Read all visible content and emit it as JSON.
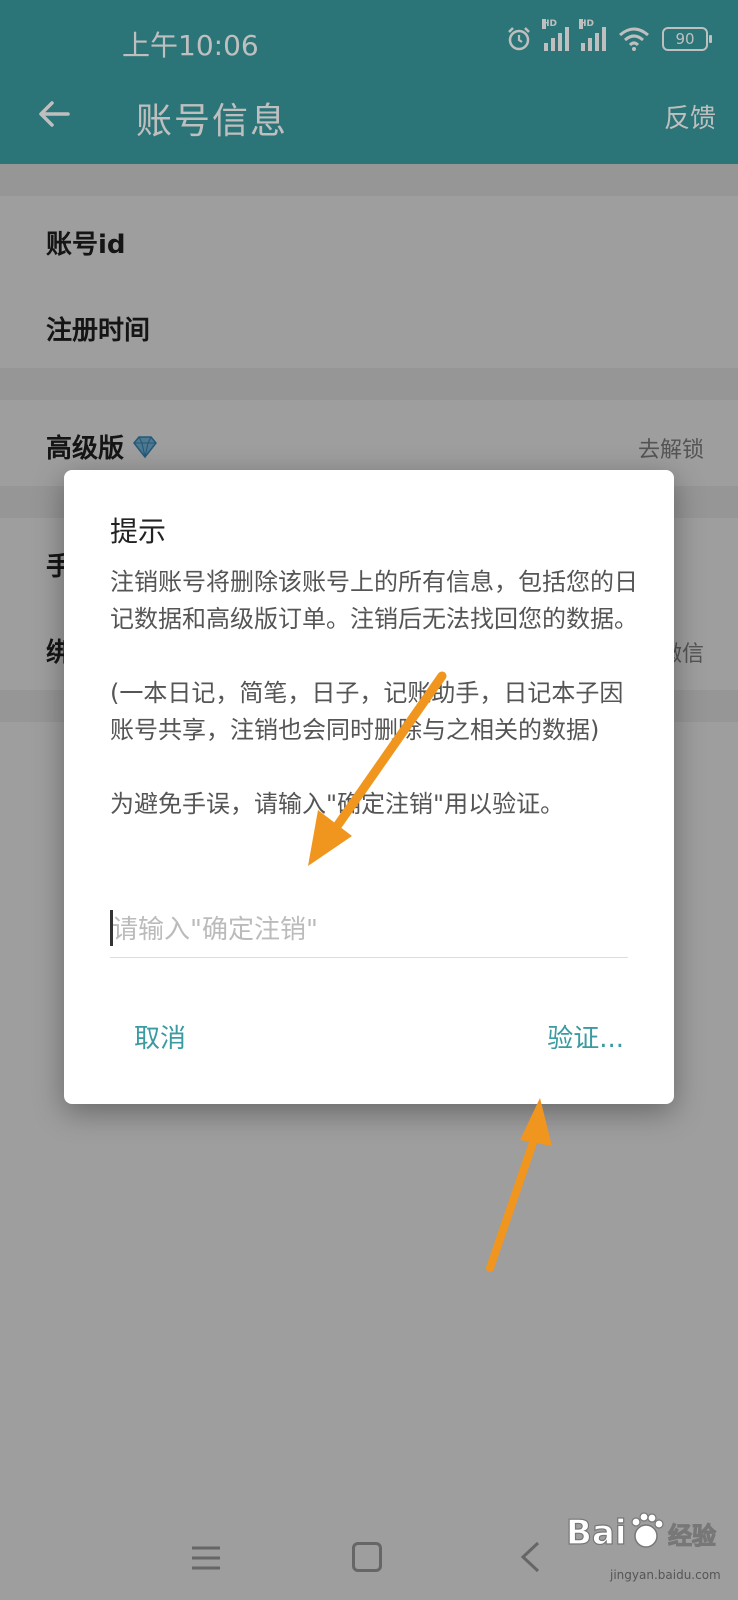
{
  "status_bar": {
    "time": "上午10:06",
    "signal_badge": "HD",
    "battery": "90"
  },
  "toolbar": {
    "title": "账号信息",
    "feedback": "反馈"
  },
  "account_list": {
    "account_id_label": "账号id",
    "register_time_label": "注册时间",
    "premium_label": "高级版",
    "premium_action": "去解锁",
    "phone_label_partial": "手",
    "bind_label_partial": "绑",
    "bind_value_partial": "微信"
  },
  "dialog": {
    "title": "提示",
    "paragraph1": "注销账号将删除该账号上的所有信息，包括您的日记数据和高级版订单。注销后无法找回您的数据。",
    "paragraph2": "(一本日记，简笔，日子，记账助手，日记本子因账号共享，注销也会同时删除与之相关的数据)",
    "paragraph3": "为避免手误，请输入\"确定注销\"用以验证。",
    "input_placeholder": "请输入\"确定注销\"",
    "input_value": "",
    "cancel_label": "取消",
    "verify_label": "验证..."
  },
  "watermark": {
    "url": "jingyan.baidu.com"
  },
  "colors": {
    "brand": "#3a9ba0",
    "arrow": "#f0961e"
  }
}
